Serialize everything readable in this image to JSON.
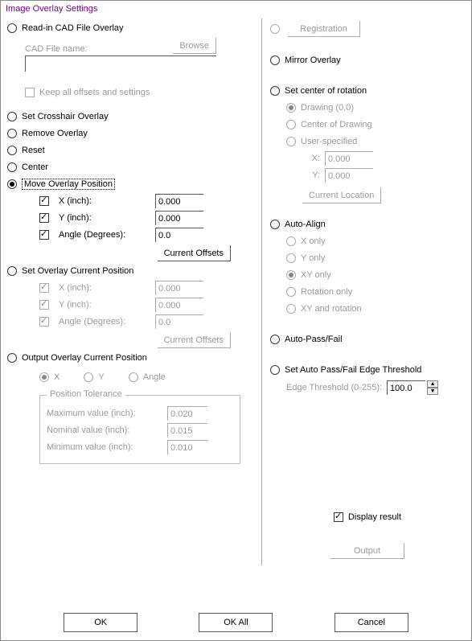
{
  "title": "Image Overlay Settings",
  "left": {
    "read_in": {
      "label": "Read-in CAD File Overlay",
      "selected": false
    },
    "cad_file_label": "CAD File name:",
    "browse": "Browse",
    "cad_path": "",
    "keep_offsets": {
      "label": "Keep all offsets and settings",
      "checked": false
    },
    "set_crosshair": {
      "label": "Set Crosshair Overlay",
      "selected": false
    },
    "remove": {
      "label": "Remove Overlay",
      "selected": false
    },
    "reset": {
      "label": "Reset",
      "selected": false
    },
    "center": {
      "label": "Center",
      "selected": false
    },
    "move_pos": {
      "label": "Move Overlay Position",
      "selected": true
    },
    "move": {
      "x": {
        "label": "X (inch):",
        "checked": true,
        "value": "0.000"
      },
      "y": {
        "label": "Y (inch):",
        "checked": true,
        "value": "0.000"
      },
      "angle": {
        "label": "Angle (Degrees):",
        "checked": true,
        "value": "0.0"
      },
      "current_offsets": "Current Offsets"
    },
    "set_current": {
      "label": "Set Overlay Current Position",
      "selected": false
    },
    "cur": {
      "x": {
        "label": "X (inch):",
        "checked": true,
        "value": "0.000"
      },
      "y": {
        "label": "Y (inch):",
        "checked": true,
        "value": "0.000"
      },
      "angle": {
        "label": "Angle (Degrees):",
        "checked": true,
        "value": "0.0"
      },
      "current_offsets": "Current Offsets"
    },
    "output_pos": {
      "label": "Output Overlay Current Position",
      "selected": false
    },
    "output_axis": {
      "x": {
        "label": "X",
        "selected": true
      },
      "y": {
        "label": "Y",
        "selected": false
      },
      "angle": {
        "label": "Angle",
        "selected": false
      }
    },
    "tolerance": {
      "legend": "Position Tolerance",
      "max": {
        "label": "Maximum value (inch):",
        "value": "0.020"
      },
      "nom": {
        "label": "Nominal value (inch):",
        "value": "0.015"
      },
      "min": {
        "label": "Minimum value (inch):",
        "value": "0.010"
      }
    }
  },
  "right": {
    "registration": {
      "label": "Registration",
      "selected": false
    },
    "mirror": {
      "label": "Mirror Overlay",
      "selected": false
    },
    "set_center": {
      "label": "Set center of rotation",
      "selected": false
    },
    "center_mode": {
      "drawing00": {
        "label": "Drawing (0,0)",
        "selected": true
      },
      "center_of_drawing": {
        "label": "Center of Drawing",
        "selected": false
      },
      "user": {
        "label": "User-specified",
        "selected": false
      },
      "x": {
        "label": "X:",
        "value": "0.000"
      },
      "y": {
        "label": "Y:",
        "value": "0.000"
      },
      "current_location": "Current Location"
    },
    "auto_align": {
      "label": "Auto-Align",
      "selected": false
    },
    "align_mode": {
      "x_only": {
        "label": "X only",
        "selected": false
      },
      "y_only": {
        "label": "Y only",
        "selected": false
      },
      "xy_only": {
        "label": "XY only",
        "selected": true
      },
      "rotation_only": {
        "label": "Rotation only",
        "selected": false
      },
      "xy_and_rotation": {
        "label": "XY and rotation",
        "selected": false
      }
    },
    "auto_pass_fail": {
      "label": "Auto-Pass/Fail",
      "selected": false
    },
    "set_auto_threshold": {
      "label": "Set Auto Pass/Fail Edge Threshold",
      "selected": false
    },
    "edge_threshold": {
      "label": "Edge Threshold (0-255):",
      "value": "100.0"
    },
    "display_result": {
      "label": "Display result",
      "checked": true
    },
    "output_btn": "Output"
  },
  "buttons": {
    "ok": "OK",
    "ok_all": "OK All",
    "cancel": "Cancel"
  }
}
